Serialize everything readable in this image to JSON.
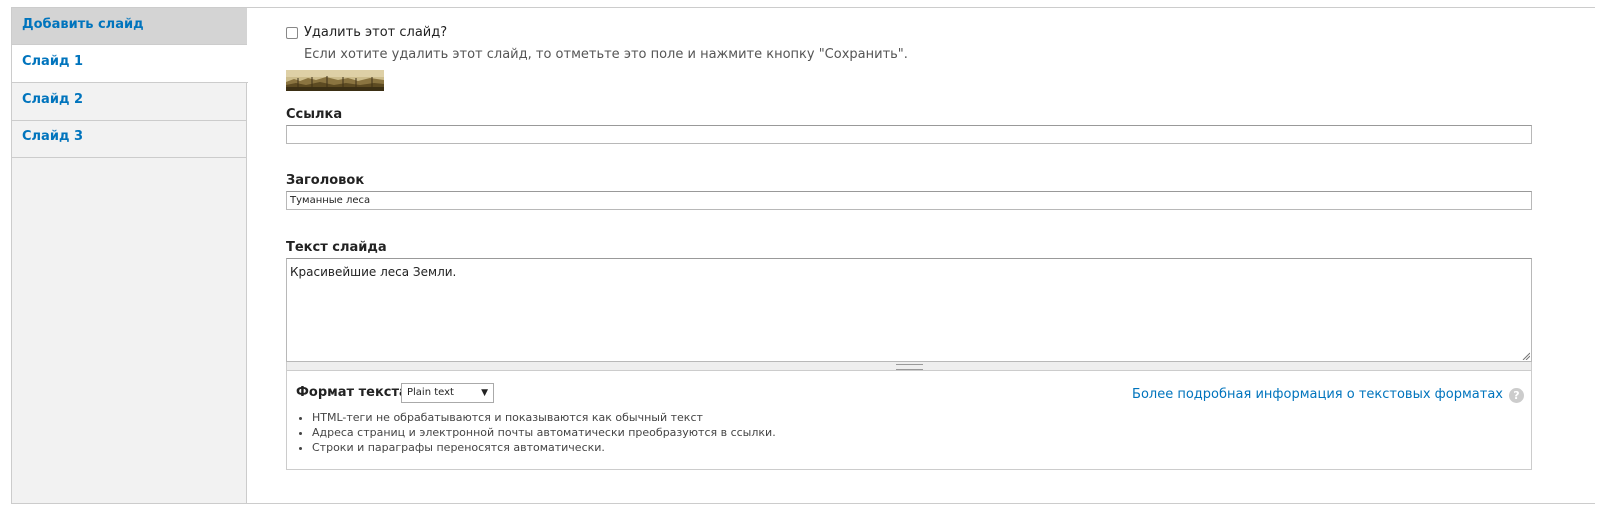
{
  "tabs": [
    {
      "label": "Добавить слайд"
    },
    {
      "label": "Слайд 1"
    },
    {
      "label": "Слайд 2"
    },
    {
      "label": "Слайд 3"
    }
  ],
  "delete": {
    "label": "Удалить этот слайд?",
    "checked": false,
    "description": "Если хотите удалить этот слайд, то отметьте это поле и нажмите кнопку \"Сохранить\"."
  },
  "fields": {
    "link": {
      "label": "Ссылка",
      "value": ""
    },
    "title": {
      "label": "Заголовок",
      "value": "Туманные леса"
    },
    "body": {
      "label": "Текст слайда",
      "value": "Красивейшие леса Земли."
    }
  },
  "format": {
    "label": "Формат текста",
    "selected": "Plain text",
    "more_link": "Более подробная информация о текстовых форматах",
    "help_icon": "?",
    "tips": [
      "HTML-теги не обрабатываются и показываются как обычный текст",
      "Адреса страниц и электронной почты автоматически преобразуются в ссылки.",
      "Строки и параграфы переносятся автоматически."
    ]
  },
  "colors": {
    "link": "#0074bd",
    "tab_bg": "#f2f2f2",
    "border": "#cccccc"
  },
  "icons": {
    "checkbox": "checkbox-icon",
    "thumbnail": "forest-thumbnail",
    "select_arrow": "triangle-down-icon",
    "help": "help-icon"
  }
}
